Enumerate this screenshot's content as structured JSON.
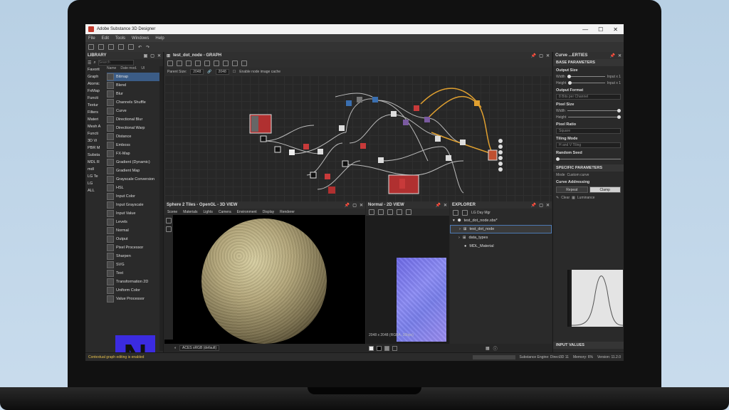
{
  "window": {
    "title": "Adobe Substance 3D Designer",
    "min": "—",
    "max": "☐",
    "close": "✕"
  },
  "menu": [
    "File",
    "Edit",
    "Tools",
    "Windows",
    "Help"
  ],
  "library": {
    "title": "LIBRARY",
    "search_placeholder": "Search",
    "columns": [
      "Name",
      "Date mod.",
      "UI"
    ],
    "tree": [
      "Favorit",
      "Graph",
      "Atomic",
      "FxMap",
      "Functi",
      "Textur",
      "Filters",
      "Materi",
      "Mesh A",
      "Functi",
      "3D Vi",
      "PBR M",
      "Substa",
      "MDL R",
      "mdl",
      "LG Te",
      "LG",
      "ALL"
    ],
    "items": [
      "Bitmap",
      "Blend",
      "Blur",
      "Channels Shuffle",
      "Curve",
      "Directional Blur",
      "Directional Warp",
      "Distance",
      "Emboss",
      "FX-Map",
      "Gradient (Dynamic)",
      "Gradient Map",
      "Grayscale Conversion",
      "HSL",
      "Input Color",
      "Input Grayscale",
      "Input Value",
      "Levels",
      "Normal",
      "Output",
      "Pixel Processor",
      "Sharpen",
      "SVG",
      "Text",
      "Transformation 2D",
      "Uniform Color",
      "Value Processor"
    ],
    "selected_index": 0,
    "badge": "N"
  },
  "graph": {
    "title": "test_dot_node - GRAPH",
    "parent_size_label": "Parent Size:",
    "parent_size_value": "2048",
    "size_value": "2048",
    "cache_label": "Enable node image cache"
  },
  "view3d": {
    "title": "Sphere 2 Tiles - OpenGL - 3D VIEW",
    "menu": [
      "Scene",
      "Materials",
      "Lights",
      "Camera",
      "Environment",
      "Display",
      "Renderer"
    ],
    "colorspace": "ACES sRGB (default)"
  },
  "view2d": {
    "title": "Normal - 2D VIEW",
    "resolution": "2048 x 2048 (RGBA, 16bpc)"
  },
  "explorer": {
    "title": "EXPLORER",
    "dock_label": "LG Day Mgr",
    "package": "test_dot_node.sbs*",
    "items": [
      "test_dot_node",
      "data_types",
      "MDL_Material"
    ]
  },
  "props": {
    "title": "Curve ...ERTIES",
    "base_section": "BASE PARAMETERS",
    "output_size": "Output Size",
    "width": "Width",
    "height": "Height",
    "relative": "Input x 1",
    "output_format": "Output Format",
    "output_format_value": "8 Bits per Channel",
    "pixel_size": "Pixel Size",
    "pixel_ratio": "Pixel Ratio",
    "pixel_ratio_value": "Square",
    "tiling_mode": "Tiling Mode",
    "tiling_value": "H and V Tiling",
    "random_seed": "Random Seed",
    "specific_section": "SPECIFIC PARAMETERS",
    "mode_label": "Mode",
    "mode_value": "Custom curve",
    "curve_addressing": "Curve Addressing",
    "repeat": "Repeat",
    "clamp": "Clamp",
    "clear": "Clear",
    "channel": "Luminance",
    "input_values": "INPUT VALUES"
  },
  "status": {
    "message": "Contextual graph editing is enabled",
    "engine": "Substance Engine: Direct3D 11",
    "memory": "Memory: 6%",
    "version": "Version: 11.2.0"
  }
}
